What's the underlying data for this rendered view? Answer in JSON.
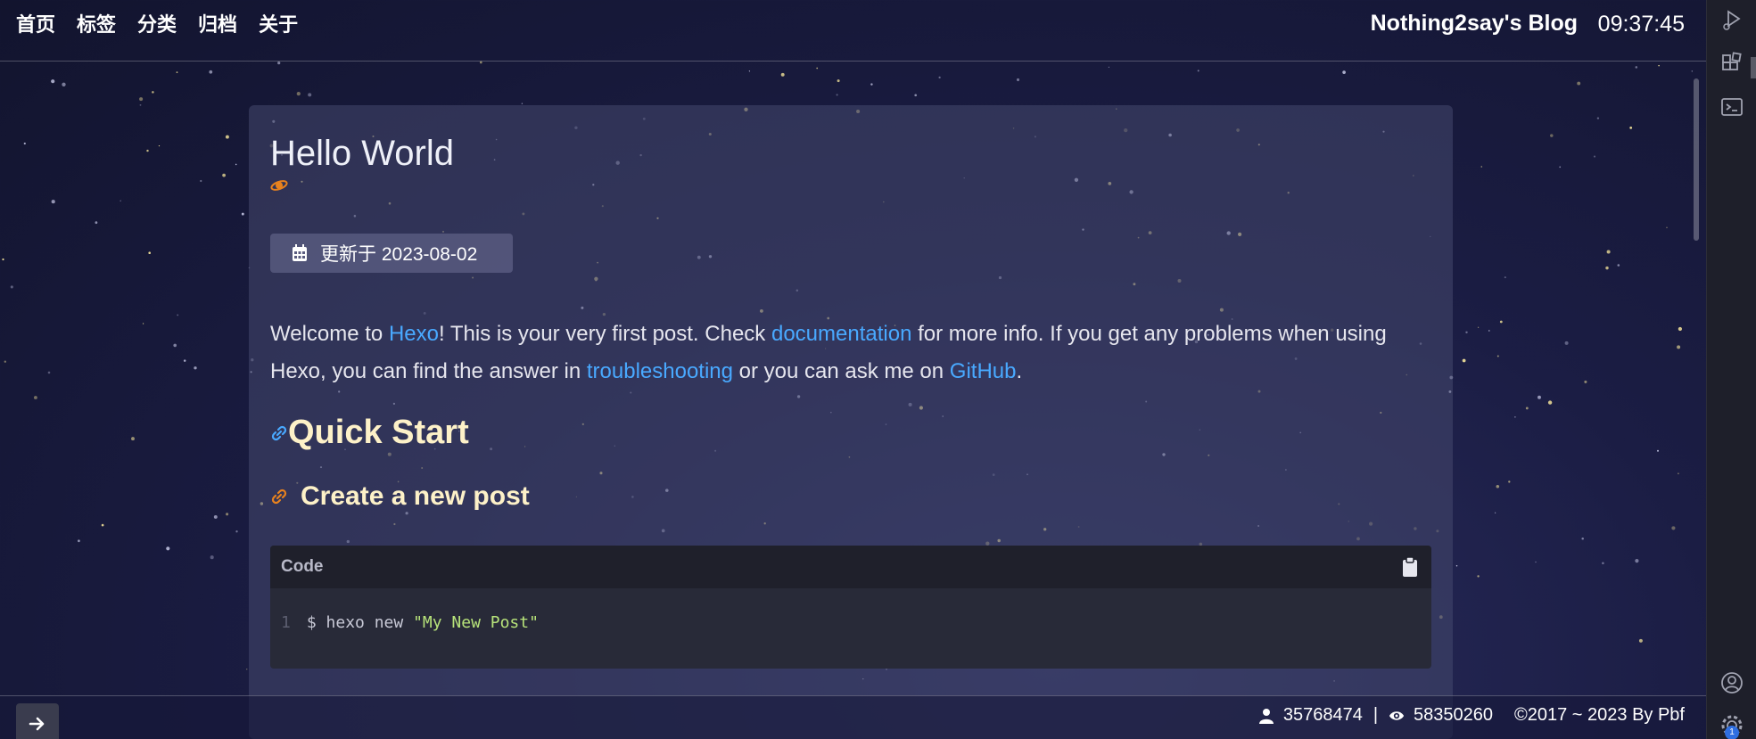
{
  "nav": {
    "items": [
      "首页",
      "标签",
      "分类",
      "归档",
      "关于"
    ],
    "brand": "Nothing2say's Blog",
    "clock": "09:37:45"
  },
  "post": {
    "title": "Hello World",
    "updated": "更新于 2023-08-02",
    "intro": {
      "t1": "Welcome to ",
      "l1": "Hexo",
      "t2": "! This is your very first post. Check ",
      "l2": "documentation",
      "t3": " for more info. If you get any problems when using Hexo, you can find the answer in ",
      "l3": "troubleshooting",
      "t4": " or you can ask me on ",
      "l4": "GitHub",
      "t5": "."
    },
    "h1": "Quick Start",
    "h2": "Create a new post",
    "code": {
      "lang": "Code",
      "line_no": "1",
      "cmd": "$ hexo new ",
      "str": "\"My New Post\""
    }
  },
  "footer": {
    "visitors": "35768474",
    "separator": "|",
    "views": "58350260",
    "copyright": "©2017 ~ 2023 By Pbf"
  },
  "activity": {
    "badge": "1"
  },
  "colors": {
    "link": "#49a9ff",
    "heading": "#fdf1c8",
    "icon_orange": "#e8821e",
    "code_string": "#b7e37a"
  }
}
